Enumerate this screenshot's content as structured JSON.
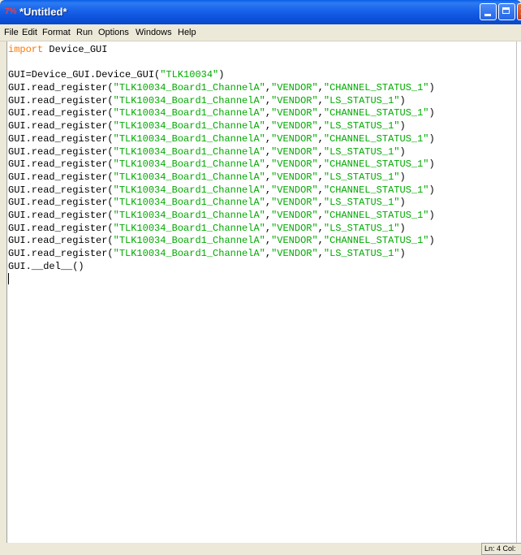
{
  "window": {
    "title": "*Untitled*",
    "icon_text": "7%"
  },
  "menu": {
    "items": [
      "File",
      "Edit",
      "Format",
      "Run",
      "Options",
      "Windows",
      "Help"
    ]
  },
  "code": {
    "lines": [
      [
        {
          "t": "kw",
          "v": "import"
        },
        {
          "t": "n",
          "v": " Device_GUI"
        }
      ],
      [],
      [
        {
          "t": "n",
          "v": "GUI=Device_GUI.Device_GUI("
        },
        {
          "t": "str",
          "v": "\"TLK10034\""
        },
        {
          "t": "n",
          "v": ")"
        }
      ],
      [
        {
          "t": "n",
          "v": "GUI.read_register("
        },
        {
          "t": "str",
          "v": "\"TLK10034_Board1_ChannelA\""
        },
        {
          "t": "n",
          "v": ","
        },
        {
          "t": "str",
          "v": "\"VENDOR\""
        },
        {
          "t": "n",
          "v": ","
        },
        {
          "t": "str",
          "v": "\"CHANNEL_STATUS_1\""
        },
        {
          "t": "n",
          "v": ")"
        }
      ],
      [
        {
          "t": "n",
          "v": "GUI.read_register("
        },
        {
          "t": "str",
          "v": "\"TLK10034_Board1_ChannelA\""
        },
        {
          "t": "n",
          "v": ","
        },
        {
          "t": "str",
          "v": "\"VENDOR\""
        },
        {
          "t": "n",
          "v": ","
        },
        {
          "t": "str",
          "v": "\"LS_STATUS_1\""
        },
        {
          "t": "n",
          "v": ")"
        }
      ],
      [
        {
          "t": "n",
          "v": "GUI.read_register("
        },
        {
          "t": "str",
          "v": "\"TLK10034_Board1_ChannelA\""
        },
        {
          "t": "n",
          "v": ","
        },
        {
          "t": "str",
          "v": "\"VENDOR\""
        },
        {
          "t": "n",
          "v": ","
        },
        {
          "t": "str",
          "v": "\"CHANNEL_STATUS_1\""
        },
        {
          "t": "n",
          "v": ")"
        }
      ],
      [
        {
          "t": "n",
          "v": "GUI.read_register("
        },
        {
          "t": "str",
          "v": "\"TLK10034_Board1_ChannelA\""
        },
        {
          "t": "n",
          "v": ","
        },
        {
          "t": "str",
          "v": "\"VENDOR\""
        },
        {
          "t": "n",
          "v": ","
        },
        {
          "t": "str",
          "v": "\"LS_STATUS_1\""
        },
        {
          "t": "n",
          "v": ")"
        }
      ],
      [
        {
          "t": "n",
          "v": "GUI.read_register("
        },
        {
          "t": "str",
          "v": "\"TLK10034_Board1_ChannelA\""
        },
        {
          "t": "n",
          "v": ","
        },
        {
          "t": "str",
          "v": "\"VENDOR\""
        },
        {
          "t": "n",
          "v": ","
        },
        {
          "t": "str",
          "v": "\"CHANNEL_STATUS_1\""
        },
        {
          "t": "n",
          "v": ")"
        }
      ],
      [
        {
          "t": "n",
          "v": "GUI.read_register("
        },
        {
          "t": "str",
          "v": "\"TLK10034_Board1_ChannelA\""
        },
        {
          "t": "n",
          "v": ","
        },
        {
          "t": "str",
          "v": "\"VENDOR\""
        },
        {
          "t": "n",
          "v": ","
        },
        {
          "t": "str",
          "v": "\"LS_STATUS_1\""
        },
        {
          "t": "n",
          "v": ")"
        }
      ],
      [
        {
          "t": "n",
          "v": "GUI.read_register("
        },
        {
          "t": "str",
          "v": "\"TLK10034_Board1_ChannelA\""
        },
        {
          "t": "n",
          "v": ","
        },
        {
          "t": "str",
          "v": "\"VENDOR\""
        },
        {
          "t": "n",
          "v": ","
        },
        {
          "t": "str",
          "v": "\"CHANNEL_STATUS_1\""
        },
        {
          "t": "n",
          "v": ")"
        }
      ],
      [
        {
          "t": "n",
          "v": "GUI.read_register("
        },
        {
          "t": "str",
          "v": "\"TLK10034_Board1_ChannelA\""
        },
        {
          "t": "n",
          "v": ","
        },
        {
          "t": "str",
          "v": "\"VENDOR\""
        },
        {
          "t": "n",
          "v": ","
        },
        {
          "t": "str",
          "v": "\"LS_STATUS_1\""
        },
        {
          "t": "n",
          "v": ")"
        }
      ],
      [
        {
          "t": "n",
          "v": "GUI.read_register("
        },
        {
          "t": "str",
          "v": "\"TLK10034_Board1_ChannelA\""
        },
        {
          "t": "n",
          "v": ","
        },
        {
          "t": "str",
          "v": "\"VENDOR\""
        },
        {
          "t": "n",
          "v": ","
        },
        {
          "t": "str",
          "v": "\"CHANNEL_STATUS_1\""
        },
        {
          "t": "n",
          "v": ")"
        }
      ],
      [
        {
          "t": "n",
          "v": "GUI.read_register("
        },
        {
          "t": "str",
          "v": "\"TLK10034_Board1_ChannelA\""
        },
        {
          "t": "n",
          "v": ","
        },
        {
          "t": "str",
          "v": "\"VENDOR\""
        },
        {
          "t": "n",
          "v": ","
        },
        {
          "t": "str",
          "v": "\"LS_STATUS_1\""
        },
        {
          "t": "n",
          "v": ")"
        }
      ],
      [
        {
          "t": "n",
          "v": "GUI.read_register("
        },
        {
          "t": "str",
          "v": "\"TLK10034_Board1_ChannelA\""
        },
        {
          "t": "n",
          "v": ","
        },
        {
          "t": "str",
          "v": "\"VENDOR\""
        },
        {
          "t": "n",
          "v": ","
        },
        {
          "t": "str",
          "v": "\"CHANNEL_STATUS_1\""
        },
        {
          "t": "n",
          "v": ")"
        }
      ],
      [
        {
          "t": "n",
          "v": "GUI.read_register("
        },
        {
          "t": "str",
          "v": "\"TLK10034_Board1_ChannelA\""
        },
        {
          "t": "n",
          "v": ","
        },
        {
          "t": "str",
          "v": "\"VENDOR\""
        },
        {
          "t": "n",
          "v": ","
        },
        {
          "t": "str",
          "v": "\"LS_STATUS_1\""
        },
        {
          "t": "n",
          "v": ")"
        }
      ],
      [
        {
          "t": "n",
          "v": "GUI.read_register("
        },
        {
          "t": "str",
          "v": "\"TLK10034_Board1_ChannelA\""
        },
        {
          "t": "n",
          "v": ","
        },
        {
          "t": "str",
          "v": "\"VENDOR\""
        },
        {
          "t": "n",
          "v": ","
        },
        {
          "t": "str",
          "v": "\"CHANNEL_STATUS_1\""
        },
        {
          "t": "n",
          "v": ")"
        }
      ],
      [
        {
          "t": "n",
          "v": "GUI.read_register("
        },
        {
          "t": "str",
          "v": "\"TLK10034_Board1_ChannelA\""
        },
        {
          "t": "n",
          "v": ","
        },
        {
          "t": "str",
          "v": "\"VENDOR\""
        },
        {
          "t": "n",
          "v": ","
        },
        {
          "t": "str",
          "v": "\"LS_STATUS_1\""
        },
        {
          "t": "n",
          "v": ")"
        }
      ],
      [
        {
          "t": "n",
          "v": "GUI.__del__()"
        }
      ]
    ]
  },
  "status": {
    "position": "Ln: 4 Col:"
  },
  "colors": {
    "keyword": "#ff7700",
    "string": "#00aa00",
    "titlebar": "#0b4fd8"
  }
}
